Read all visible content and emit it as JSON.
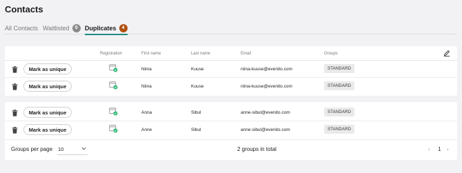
{
  "page": {
    "title": "Contacts"
  },
  "tabs": [
    {
      "label": "All Contacts",
      "count": ""
    },
    {
      "label": "Waitlisted",
      "count": "0"
    },
    {
      "label": "Duplicates",
      "count": "4"
    }
  ],
  "table": {
    "headers": {
      "registration": "Registration",
      "first_name": "First name",
      "last_name": "Last name",
      "email": "Email",
      "groups": "Groups"
    },
    "groups": [
      {
        "rows": [
          {
            "action": "Mark as unique",
            "first_name": "Niina",
            "last_name": "Kuuse",
            "email": "niina-kuuse@evenito.com",
            "group": "STANDARD"
          },
          {
            "action": "Mark as unique",
            "first_name": "Niina",
            "last_name": "Kuuse",
            "email": "niina-kuuse@evenito.com",
            "group": "STANDARD"
          }
        ]
      },
      {
        "rows": [
          {
            "action": "Mark as unique",
            "first_name": "Anna",
            "last_name": "Sibul",
            "email": "anne-sibul@evenito.com",
            "group": "STANDARD"
          },
          {
            "action": "Mark as unique",
            "first_name": "Anne",
            "last_name": "Sibul",
            "email": "anne-sibul@evenito.com",
            "group": "STANDARD"
          }
        ]
      }
    ]
  },
  "footer": {
    "groups_per_page_label": "Groups per page",
    "groups_per_page_value": "10",
    "total_text": "2 groups in total",
    "prev": "‹",
    "current_page": "1",
    "next": "›"
  },
  "icons": {
    "trash": "trash-icon",
    "registration": "calendar-check-icon",
    "edit": "pencil-icon",
    "chevron": "chevron-down-icon"
  },
  "colors": {
    "accent": "#1f8a80",
    "duplicates_badge": "#b0500e",
    "waitlisted_badge": "#8b8b8b",
    "check_green": "#2bb673"
  }
}
